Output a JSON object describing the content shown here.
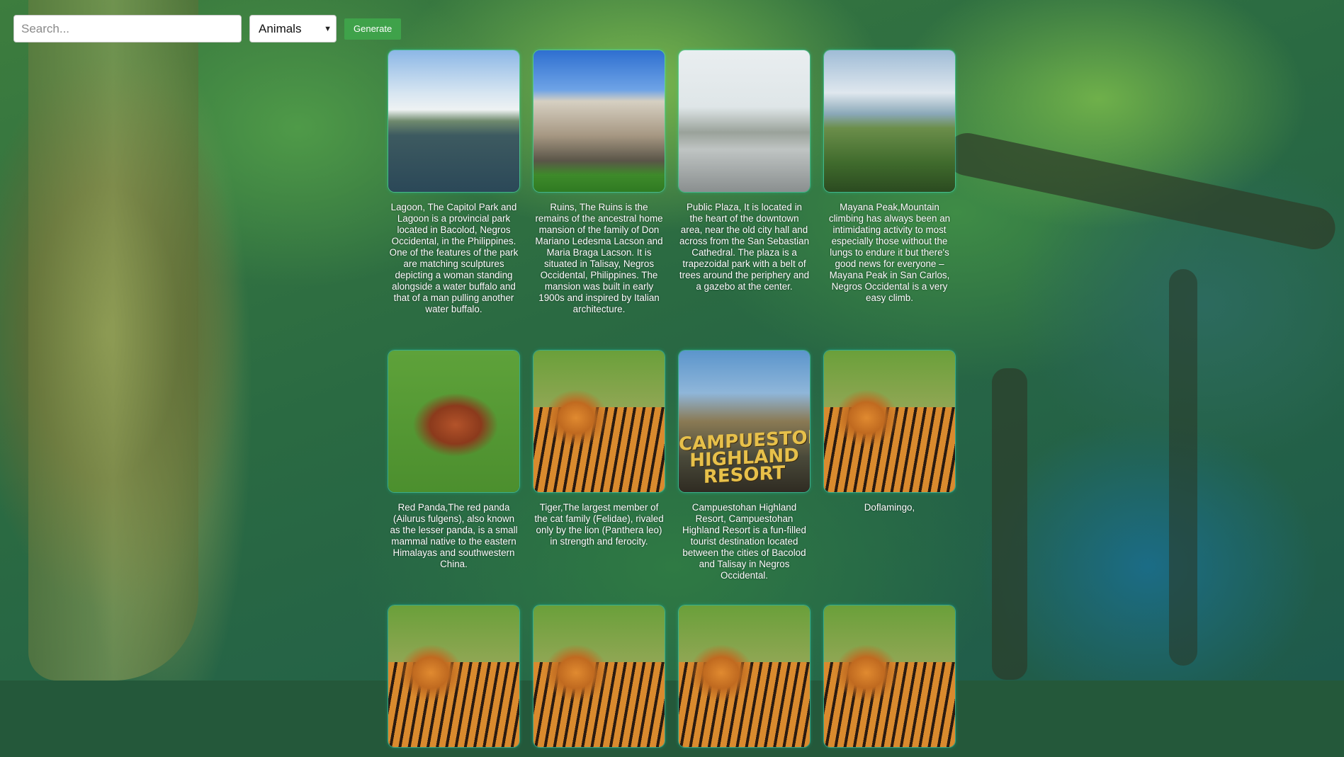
{
  "search": {
    "placeholder": "Search..."
  },
  "category_select": {
    "selected": "Animals"
  },
  "generate_button": {
    "label": "Generate"
  },
  "cards": [
    {
      "image": "capitol-lagoon-photo",
      "text": "Lagoon, The Capitol Park and Lagoon is a provincial park located in Bacolod, Negros Occidental, in the Philippines. One of the features of the park are matching sculptures depicting a woman standing alongside a water buffalo and that of a man pulling another water buffalo."
    },
    {
      "image": "the-ruins-photo",
      "text": "Ruins, The Ruins is the remains of the ancestral home mansion of the family of Don Mariano Ledesma Lacson and Maria Braga Lacson. It is situated in Talisay, Negros Occidental, Philippines. The mansion was built in early 1900s and inspired by Italian architecture."
    },
    {
      "image": "public-plaza-photo",
      "text": "Public Plaza, It is located in the heart of the downtown area, near the old city hall and across from the San Sebastian Cathedral. The plaza is a trapezoidal park with a belt of trees around the periphery and a gazebo at the center."
    },
    {
      "image": "mayana-peak-photo",
      "text": "Mayana Peak,Mountain climbing has always been an intimidating activity to most especially those without the lungs to endure it but there's good news for everyone – Mayana Peak in San Carlos, Negros Occidental is a very easy climb."
    },
    {
      "image": "red-panda-photo",
      "text": "Red Panda,The red panda (Ailurus fulgens), also known as the lesser panda, is a small mammal native to the eastern Himalayas and southwestern China."
    },
    {
      "image": "tiger-photo",
      "text": "Tiger,The largest member of the cat family (Felidae), rivaled only by the lion (Panthera leo) in strength and ferocity."
    },
    {
      "image": "campuestohan-resort-photo",
      "sign_text": "CAMPUESTOHAN HIGHLAND RESORT",
      "text": "Campuestohan Highland Resort, Campuestohan Highland Resort is a fun-filled tourist destination located between the cities of Bacolod and Talisay in Negros Occidental."
    },
    {
      "image": "tiger-photo",
      "text": "Doflamingo,"
    },
    {
      "image": "tiger-photo",
      "text": ""
    },
    {
      "image": "tiger-photo",
      "text": ""
    },
    {
      "image": "tiger-photo",
      "text": ""
    },
    {
      "image": "tiger-photo",
      "text": ""
    }
  ]
}
